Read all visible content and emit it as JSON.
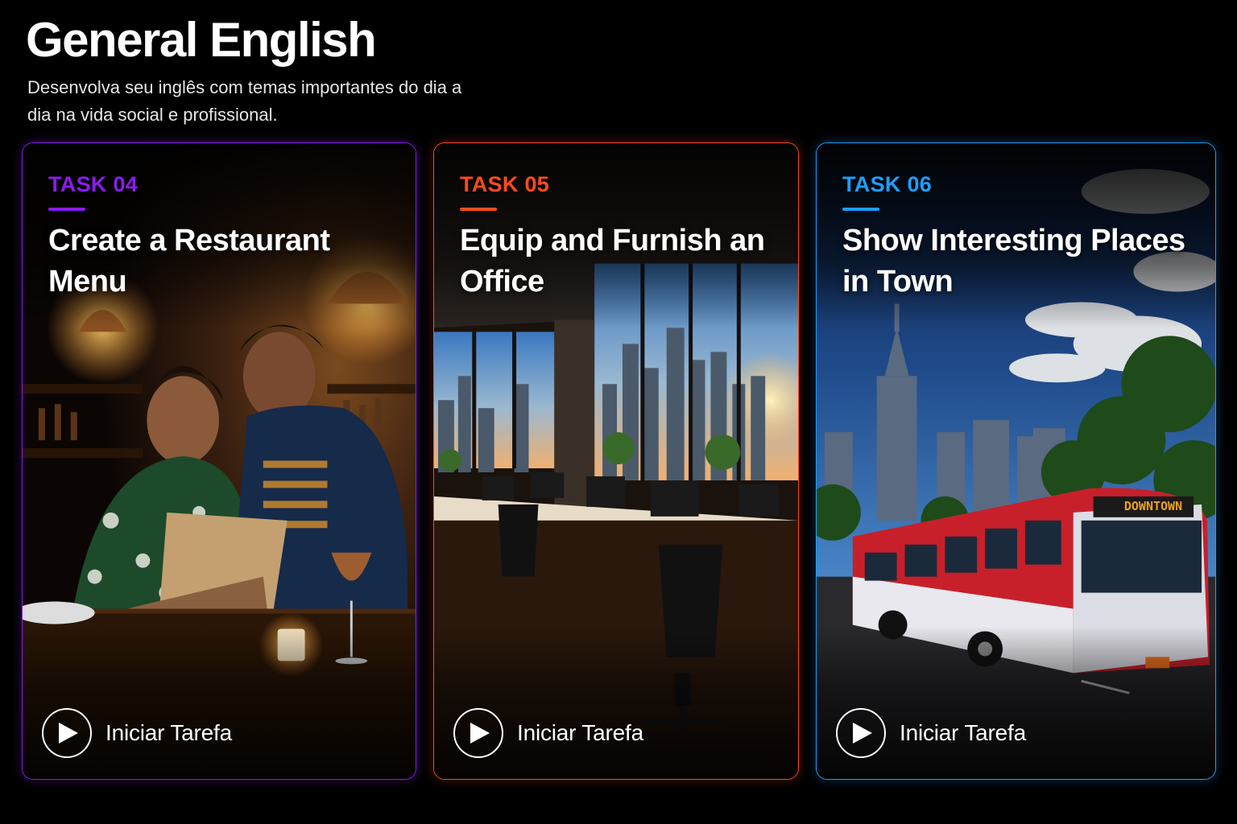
{
  "header": {
    "title": "General English",
    "subtitle": "Desenvolva seu inglês com temas importantes do dia a dia na vida social e profissional."
  },
  "cards": [
    {
      "task": "TASK 04",
      "title": "Create a Restaurant Menu",
      "action_label": "Iniciar Tarefa",
      "icon": "play-icon",
      "accent": "#8a1cf0"
    },
    {
      "task": "TASK 05",
      "title": "Equip and Furnish an Office",
      "action_label": "Iniciar Tarefa",
      "icon": "play-icon",
      "accent": "#ff4a1c"
    },
    {
      "task": "TASK 06",
      "title": "Show Interesting Places in Town",
      "action_label": "Iniciar Tarefa",
      "icon": "play-icon",
      "accent": "#1aa0ff",
      "scene_texts": {
        "bus_destination": "DOWNTOWN"
      }
    }
  ]
}
